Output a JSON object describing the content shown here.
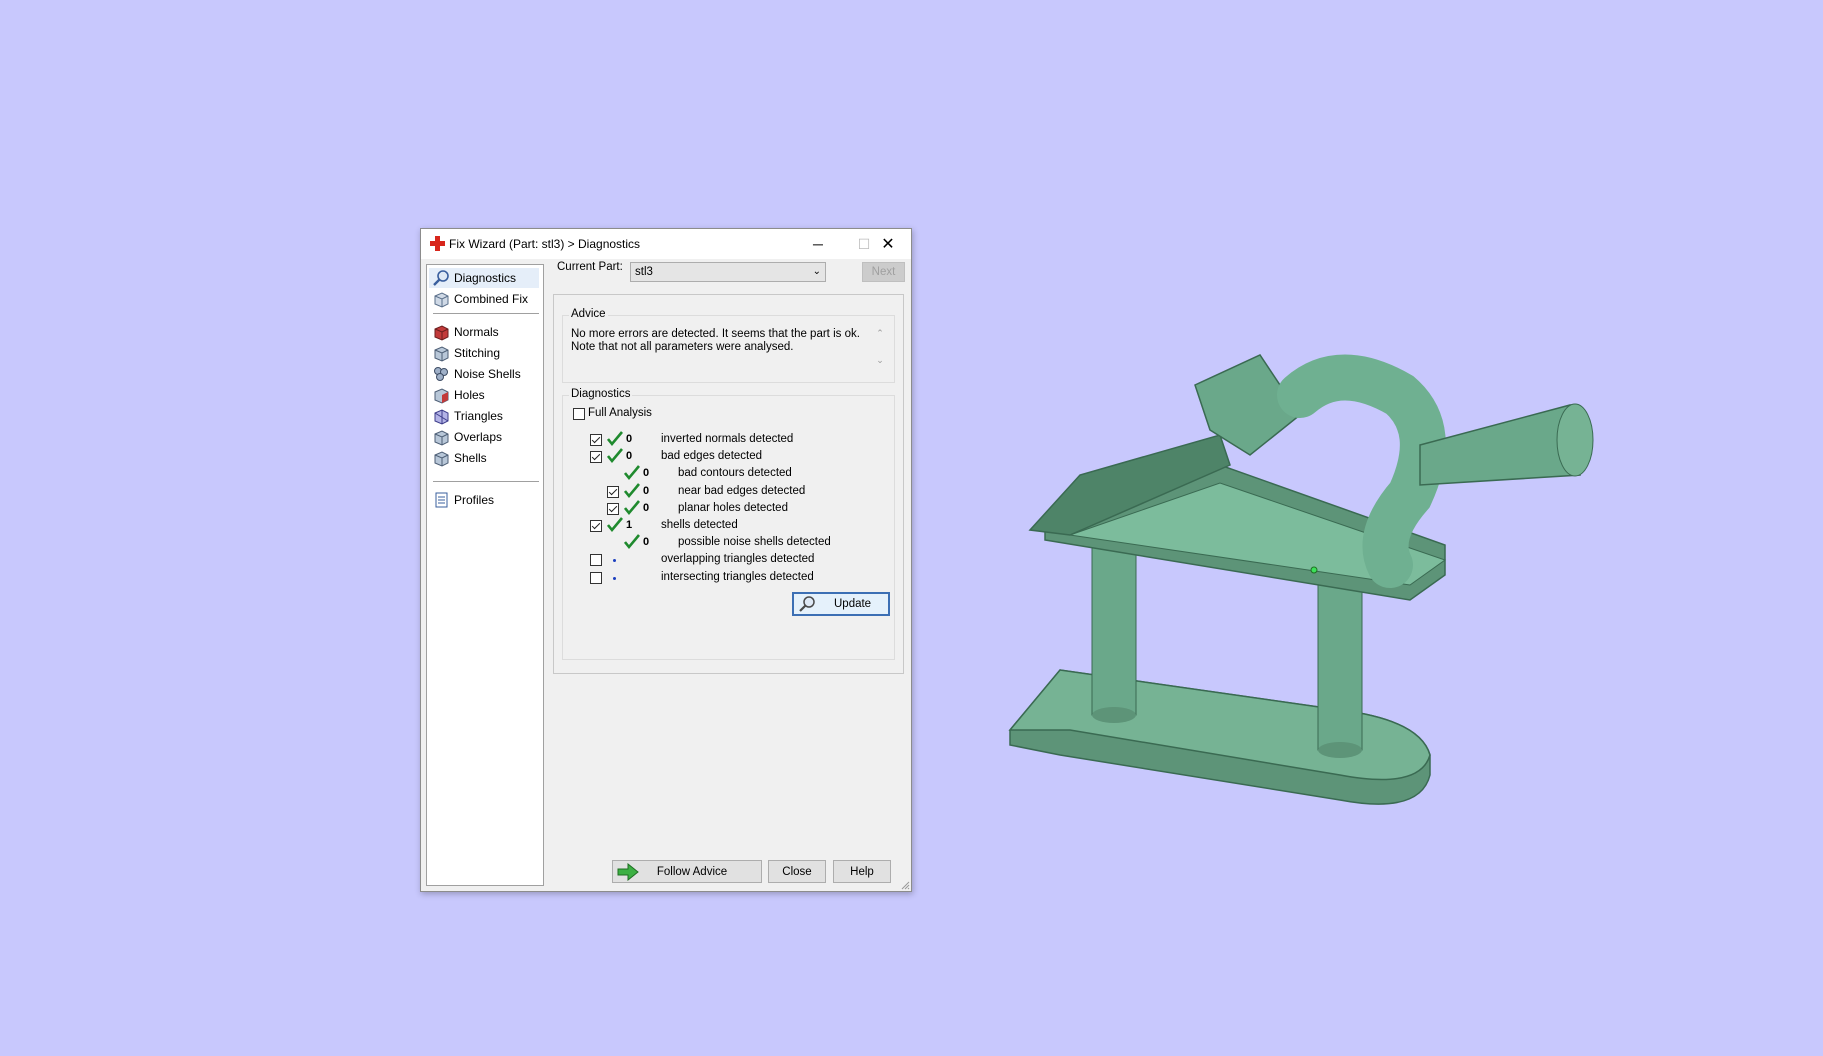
{
  "window": {
    "title": "Fix Wizard (Part: stl3) > Diagnostics",
    "minimize_glyph": "─",
    "maximize_glyph": "☐",
    "close_glyph": "✕"
  },
  "nav": {
    "items_top": [
      {
        "label": "Diagnostics",
        "icon": "magnifier-icon"
      },
      {
        "label": "Combined Fix",
        "icon": "combined-fix-icon"
      }
    ],
    "items_mid": [
      {
        "label": "Normals",
        "icon": "normals-icon"
      },
      {
        "label": "Stitching",
        "icon": "stitching-icon"
      },
      {
        "label": "Noise Shells",
        "icon": "noise-shells-icon"
      },
      {
        "label": "Holes",
        "icon": "holes-icon"
      },
      {
        "label": "Triangles",
        "icon": "triangles-icon"
      },
      {
        "label": "Overlaps",
        "icon": "overlaps-icon"
      },
      {
        "label": "Shells",
        "icon": "shells-icon"
      }
    ],
    "items_bottom": [
      {
        "label": "Profiles",
        "icon": "profiles-icon"
      }
    ]
  },
  "current_part": {
    "label": "Current Part:",
    "value": "stl3",
    "next_label": "Next"
  },
  "advice": {
    "title": "Advice",
    "line1": "No more errors are detected. It seems that the part is ok.",
    "line2": "Note that not all parameters were analysed."
  },
  "diagnostics": {
    "title": "Diagnostics",
    "full_analysis_label": "Full Analysis",
    "rows": [
      {
        "checked": true,
        "status": "ok",
        "count": "0",
        "text": "inverted normals detected",
        "level": 0,
        "has_checkbox": true
      },
      {
        "checked": true,
        "status": "ok",
        "count": "0",
        "text": "bad edges detected",
        "level": 0,
        "has_checkbox": true
      },
      {
        "checked": false,
        "status": "ok",
        "count": "0",
        "text": "bad contours detected",
        "level": 1,
        "has_checkbox": false
      },
      {
        "checked": true,
        "status": "ok",
        "count": "0",
        "text": "near bad edges detected",
        "level": 1,
        "has_checkbox": true
      },
      {
        "checked": true,
        "status": "ok",
        "count": "0",
        "text": "planar holes detected",
        "level": 1,
        "has_checkbox": true
      },
      {
        "checked": true,
        "status": "ok",
        "count": "1",
        "text": "shells detected",
        "level": 0,
        "has_checkbox": true
      },
      {
        "checked": false,
        "status": "ok",
        "count": "0",
        "text": "possible noise shells detected",
        "level": 1,
        "has_checkbox": false
      },
      {
        "checked": false,
        "status": "pending",
        "count": "",
        "text": "overlapping triangles detected",
        "level": 0,
        "has_checkbox": true
      },
      {
        "checked": false,
        "status": "pending",
        "count": "",
        "text": "intersecting triangles detected",
        "level": 0,
        "has_checkbox": true
      }
    ],
    "update_label": "Update"
  },
  "footer": {
    "follow_advice_label": "Follow Advice",
    "close_label": "Close",
    "help_label": "Help"
  },
  "colors": {
    "desktop": "#c8c8fd",
    "model_green": "#6aa88a",
    "tick_green": "#1f8a2e"
  }
}
